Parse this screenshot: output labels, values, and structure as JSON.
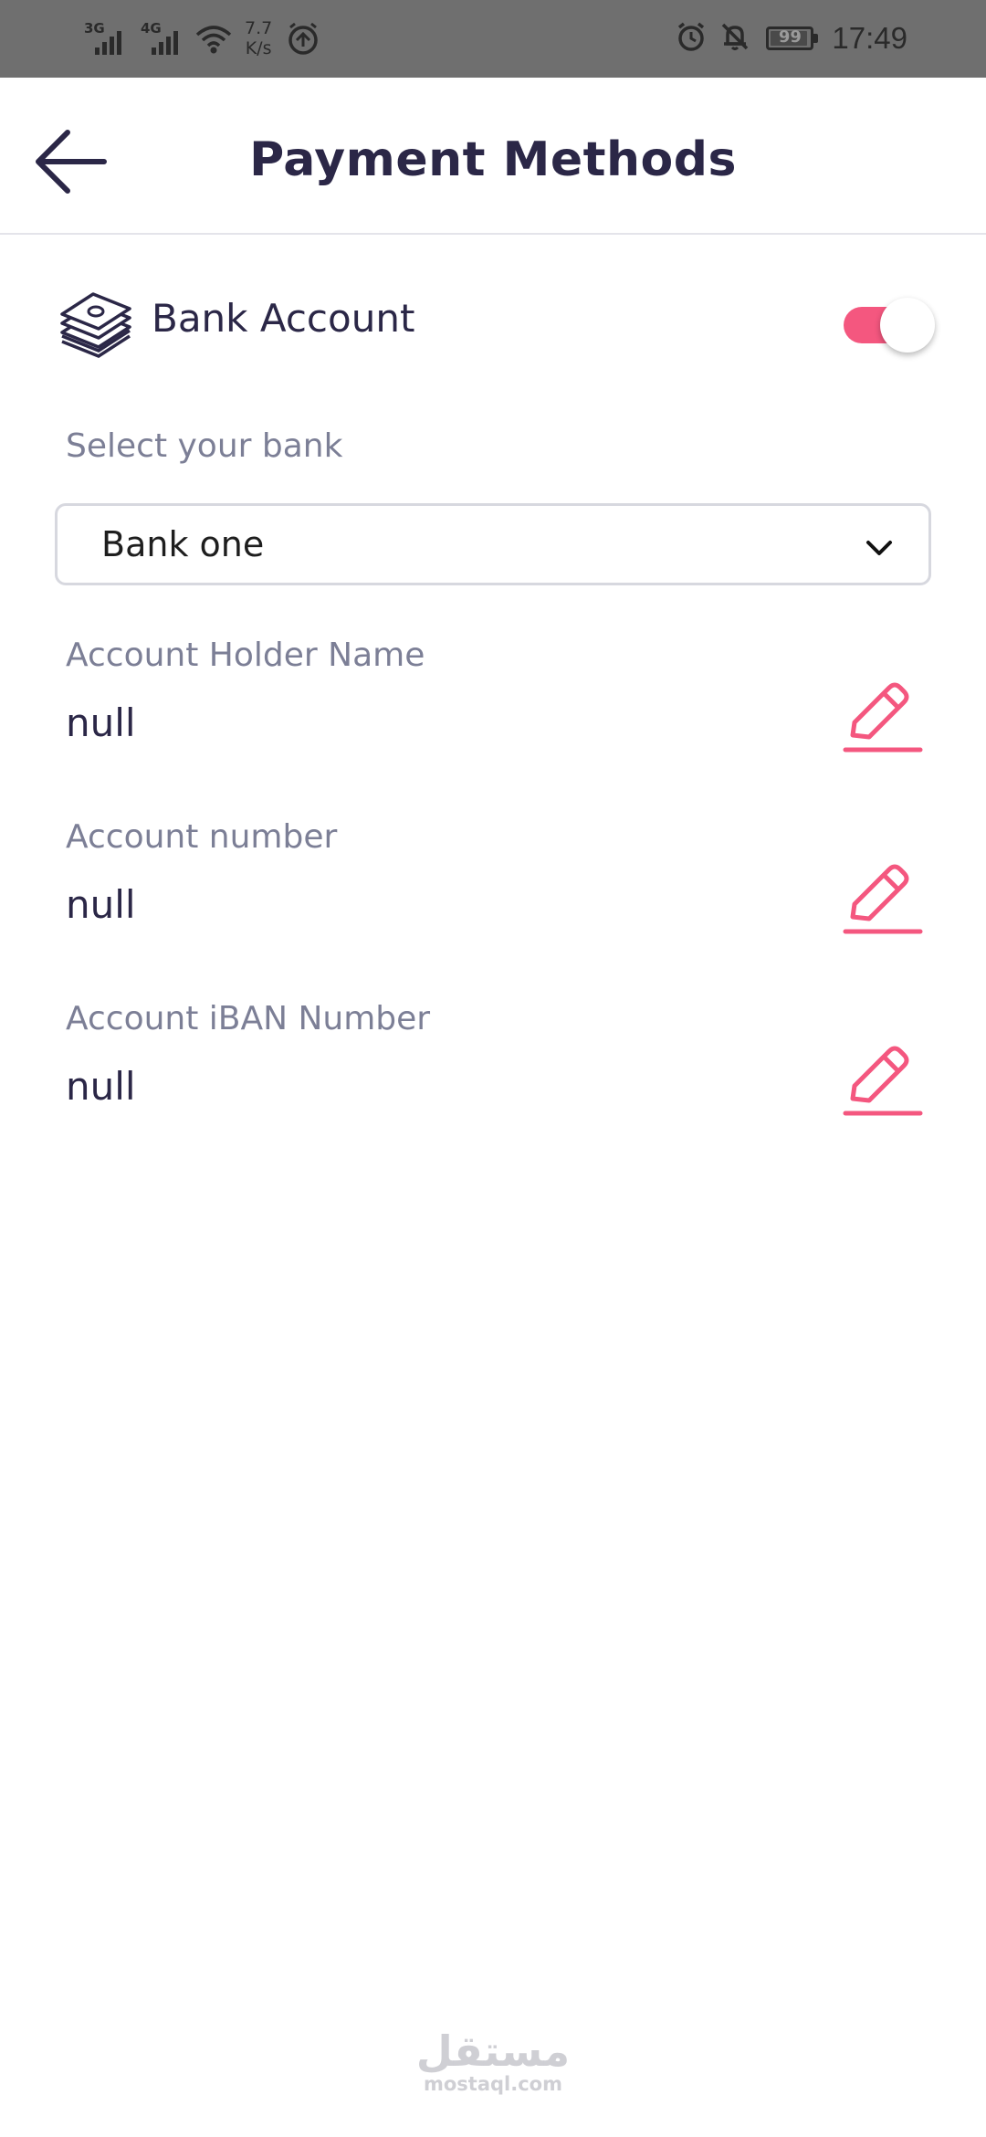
{
  "status_bar": {
    "network_1": "3G",
    "network_2": "4G",
    "speed_value": "7.7",
    "speed_unit": "K/s",
    "battery_level": "99",
    "time": "17:49"
  },
  "header": {
    "title": "Payment Methods",
    "back_icon": "arrow-left-icon"
  },
  "bank_account": {
    "icon": "money-stack-icon",
    "title": "Bank Account",
    "enabled": true,
    "accent_color": "#f4577f"
  },
  "bank_select": {
    "label": "Select your bank",
    "value": "Bank one",
    "icon": "chevron-down-icon"
  },
  "fields": [
    {
      "label": "Account Holder Name",
      "value": "null",
      "icon": "pencil-icon"
    },
    {
      "label": "Account number",
      "value": "null",
      "icon": "pencil-icon"
    },
    {
      "label": "Account iBAN Number",
      "value": "null",
      "icon": "pencil-icon"
    }
  ],
  "watermark": {
    "arabic": "مستقل",
    "latin": "mostaql.com"
  },
  "colors": {
    "primary_text": "#2b2747",
    "secondary_text": "#7c7f96",
    "accent": "#f4577f",
    "status_bar": "#6f6f6f"
  }
}
